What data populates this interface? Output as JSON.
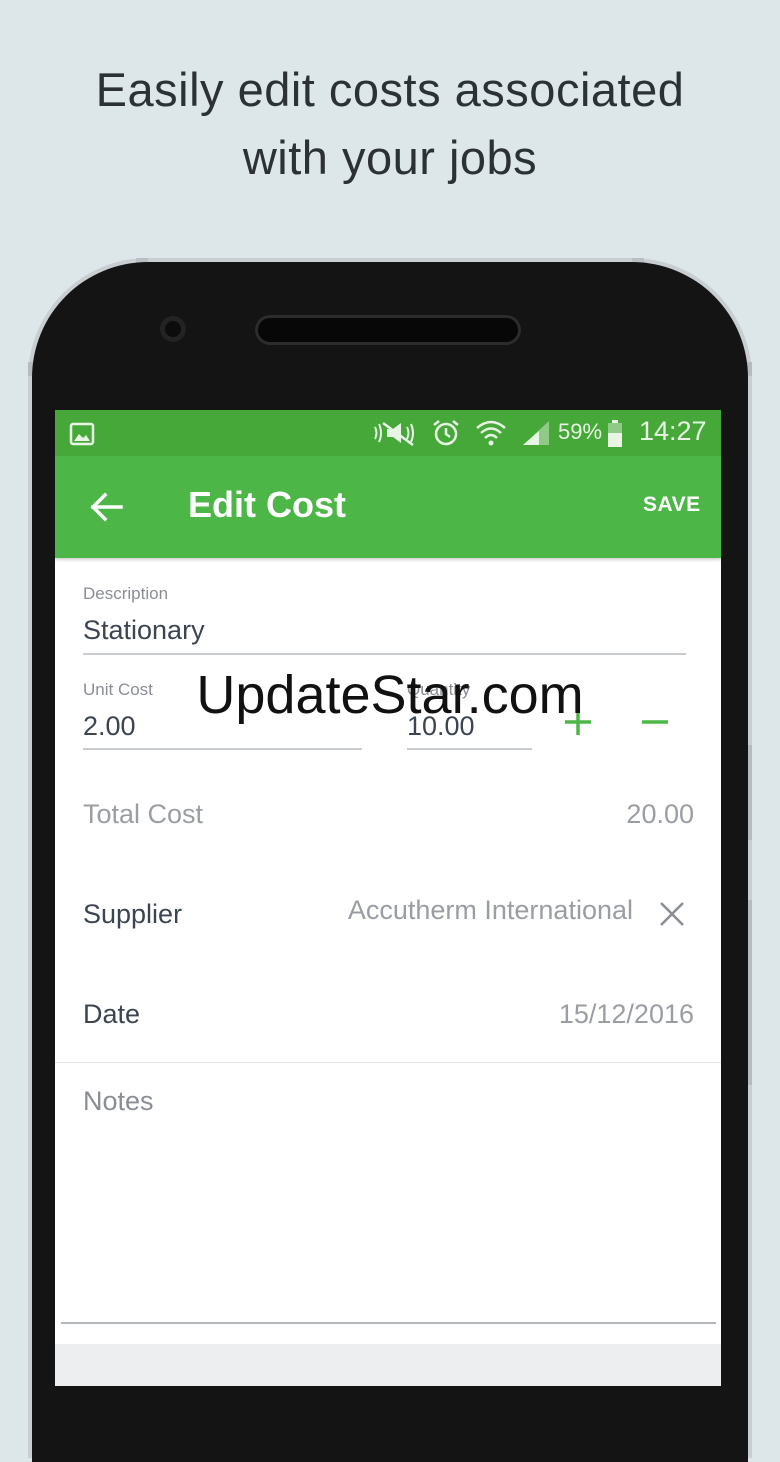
{
  "promo": {
    "line1": "Easily edit costs associated",
    "line2": "with your jobs"
  },
  "status_bar": {
    "battery_pct": "59%",
    "time": "14:27",
    "icons": [
      "image-icon",
      "mute-icon",
      "alarm-icon",
      "wifi-icon",
      "signal-icon",
      "battery-icon"
    ]
  },
  "app_bar": {
    "title": "Edit Cost",
    "save_label": "SAVE",
    "back_icon": "arrow-left-icon"
  },
  "form": {
    "description": {
      "label": "Description",
      "value": "Stationary"
    },
    "unit_cost": {
      "label": "Unit Cost",
      "value": "2.00"
    },
    "quantity": {
      "label": "Quantity",
      "value": "10.00"
    },
    "total_cost": {
      "label": "Total Cost",
      "value": "20.00"
    },
    "supplier": {
      "label": "Supplier",
      "value": "Accutherm International"
    },
    "date": {
      "label": "Date",
      "value": "15/12/2016"
    },
    "notes": {
      "label": "Notes"
    }
  },
  "watermark": "UpdateStar.com",
  "colors": {
    "status_bar": "#45a839",
    "app_bar": "#4cb647",
    "accent": "#4cb647",
    "background": "#dde7ea"
  }
}
